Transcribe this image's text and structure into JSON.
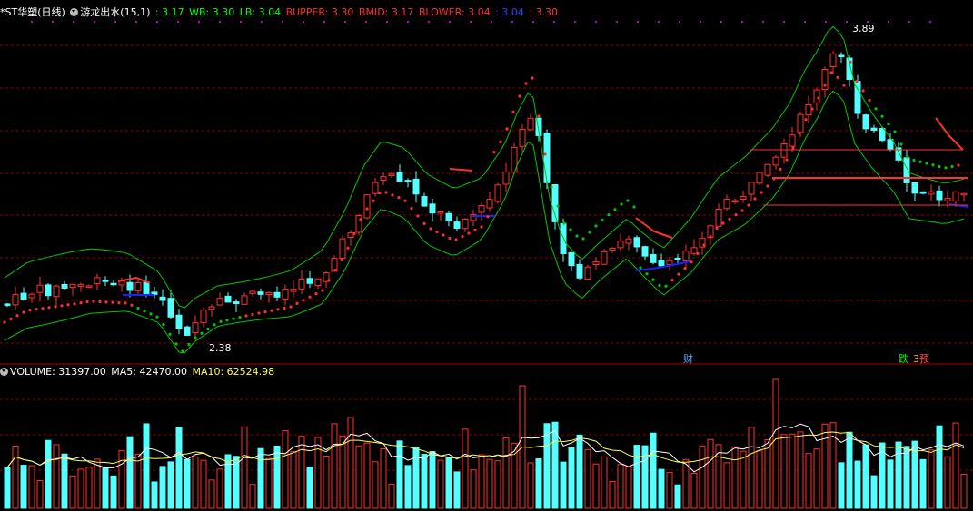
{
  "main_header": {
    "title": "*ST华塑(日线)",
    "indicator": "游龙出水(15,1)",
    "value0": ": 3.17",
    "wb": "WB: 3.30",
    "lb": "LB: 3.04",
    "bupper": "BUPPER: 3.30",
    "bmid": "BMID: 3.17",
    "blower": "BLOWER: 3.04",
    "val_blue": ": 3.04",
    "val_red": ": 3.30"
  },
  "volume_header": {
    "volume": "VOLUME: 31397.00",
    "ma5": "MA5: 42470.00",
    "ma10": "MA10: 62524.98"
  },
  "annotations": {
    "high": "3.89",
    "low": "2.38",
    "cai": "财",
    "die": "跌",
    "yu": "预"
  },
  "colors": {
    "up": "#ff3030",
    "down": "#54ffff",
    "green": "#00c800",
    "blue": "#1e1eff",
    "grid": "#8b0000",
    "white": "#ffffff",
    "yellow": "#ffff54",
    "purple": "#ff00ff"
  },
  "chart_data": [
    {
      "type": "candlestick",
      "title": "*ST华塑(日线)",
      "ylim": [
        2.3,
        3.95
      ],
      "high": 3.89,
      "low": 2.38,
      "series": [
        {
          "name": "WB",
          "last": 3.3
        },
        {
          "name": "LB",
          "last": 3.04
        },
        {
          "name": "BUPPER",
          "last": 3.3
        },
        {
          "name": "BMID",
          "last": 3.17
        },
        {
          "name": "BLOWER",
          "last": 3.04
        }
      ]
    },
    {
      "type": "bar",
      "title": "VOLUME",
      "series": [
        {
          "name": "VOLUME",
          "last": 31397.0
        },
        {
          "name": "MA5",
          "last": 42470.0
        },
        {
          "name": "MA10",
          "last": 62524.98
        }
      ]
    }
  ]
}
